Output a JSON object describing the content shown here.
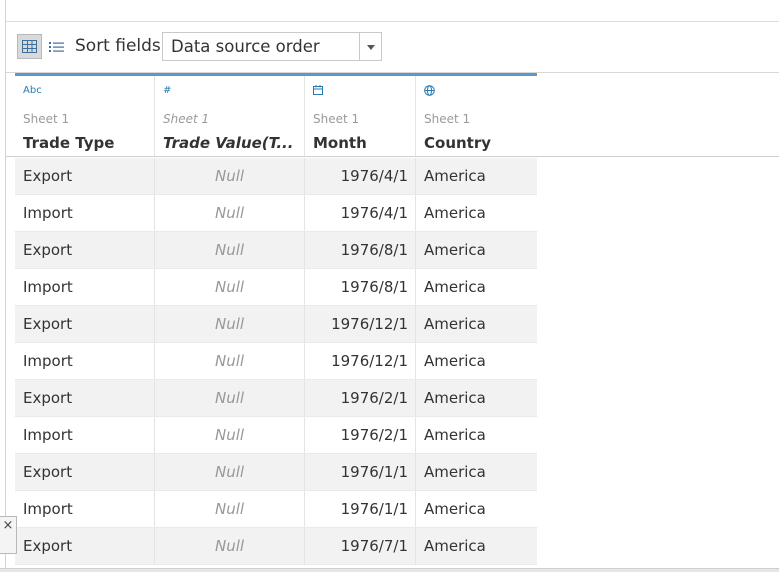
{
  "toolbar": {
    "sort_label": "Sort fields",
    "sort_value": "Data source order"
  },
  "columns": [
    {
      "type_icon": "Abc",
      "type_name": "string-type-icon",
      "sheet": "Sheet 1",
      "name": "Trade Type"
    },
    {
      "type_icon": "#",
      "type_name": "number-type-icon",
      "sheet": "Sheet 1",
      "name": "Trade Value(T..."
    },
    {
      "type_icon": "calendar",
      "type_name": "date-type-icon",
      "sheet": "Sheet 1",
      "name": "Month"
    },
    {
      "type_icon": "globe",
      "type_name": "geographic-type-icon",
      "sheet": "Sheet 1",
      "name": "Country"
    }
  ],
  "rows": [
    [
      "Export",
      "Null",
      "1976/4/1",
      "America"
    ],
    [
      "Import",
      "Null",
      "1976/4/1",
      "America"
    ],
    [
      "Export",
      "Null",
      "1976/8/1",
      "America"
    ],
    [
      "Import",
      "Null",
      "1976/8/1",
      "America"
    ],
    [
      "Export",
      "Null",
      "1976/12/1",
      "America"
    ],
    [
      "Import",
      "Null",
      "1976/12/1",
      "America"
    ],
    [
      "Export",
      "Null",
      "1976/2/1",
      "America"
    ],
    [
      "Import",
      "Null",
      "1976/2/1",
      "America"
    ],
    [
      "Export",
      "Null",
      "1976/1/1",
      "America"
    ],
    [
      "Import",
      "Null",
      "1976/1/1",
      "America"
    ],
    [
      "Export",
      "Null",
      "1976/7/1",
      "America"
    ]
  ],
  "close_glyph": "×",
  "colors": {
    "header_accent": "#5e97c9",
    "type_icon": "#2a7aae",
    "alt_row": "#f2f2f2",
    "null_text": "#999999"
  }
}
